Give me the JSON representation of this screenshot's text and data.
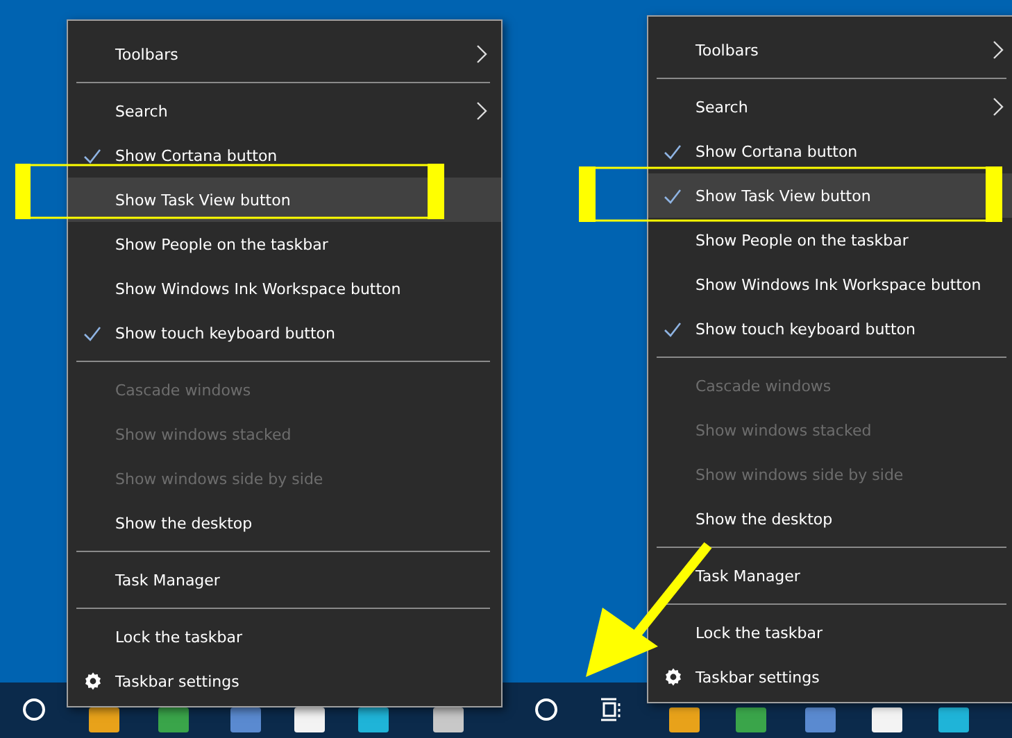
{
  "menus": [
    {
      "items": [
        {
          "kind": "item",
          "label": "Toolbars",
          "submenu": true,
          "checked": false,
          "disabled": false,
          "selected": false
        },
        {
          "kind": "separator"
        },
        {
          "kind": "item",
          "label": "Search",
          "submenu": true,
          "checked": false,
          "disabled": false,
          "selected": false
        },
        {
          "kind": "item",
          "label": "Show Cortana button",
          "submenu": false,
          "checked": true,
          "disabled": false,
          "selected": false
        },
        {
          "kind": "item",
          "label": "Show Task View button",
          "submenu": false,
          "checked": false,
          "disabled": false,
          "selected": true
        },
        {
          "kind": "item",
          "label": "Show People on the taskbar",
          "submenu": false,
          "checked": false,
          "disabled": false,
          "selected": false
        },
        {
          "kind": "item",
          "label": "Show Windows Ink Workspace button",
          "submenu": false,
          "checked": false,
          "disabled": false,
          "selected": false
        },
        {
          "kind": "item",
          "label": "Show touch keyboard button",
          "submenu": false,
          "checked": true,
          "disabled": false,
          "selected": false
        },
        {
          "kind": "separator"
        },
        {
          "kind": "item",
          "label": "Cascade windows",
          "submenu": false,
          "checked": false,
          "disabled": true,
          "selected": false
        },
        {
          "kind": "item",
          "label": "Show windows stacked",
          "submenu": false,
          "checked": false,
          "disabled": true,
          "selected": false
        },
        {
          "kind": "item",
          "label": "Show windows side by side",
          "submenu": false,
          "checked": false,
          "disabled": true,
          "selected": false
        },
        {
          "kind": "item",
          "label": "Show the desktop",
          "submenu": false,
          "checked": false,
          "disabled": false,
          "selected": false
        },
        {
          "kind": "separator"
        },
        {
          "kind": "item",
          "label": "Task Manager",
          "submenu": false,
          "checked": false,
          "disabled": false,
          "selected": false
        },
        {
          "kind": "separator"
        },
        {
          "kind": "item",
          "label": "Lock the taskbar",
          "submenu": false,
          "checked": false,
          "disabled": false,
          "selected": false
        },
        {
          "kind": "settings",
          "label": "Taskbar settings",
          "submenu": false,
          "checked": false,
          "disabled": false,
          "selected": false
        }
      ]
    },
    {
      "items": [
        {
          "kind": "item",
          "label": "Toolbars",
          "submenu": true,
          "checked": false,
          "disabled": false,
          "selected": false
        },
        {
          "kind": "separator"
        },
        {
          "kind": "item",
          "label": "Search",
          "submenu": true,
          "checked": false,
          "disabled": false,
          "selected": false
        },
        {
          "kind": "item",
          "label": "Show Cortana button",
          "submenu": false,
          "checked": true,
          "disabled": false,
          "selected": false
        },
        {
          "kind": "item",
          "label": "Show Task View button",
          "submenu": false,
          "checked": true,
          "disabled": false,
          "selected": true
        },
        {
          "kind": "item",
          "label": "Show People on the taskbar",
          "submenu": false,
          "checked": false,
          "disabled": false,
          "selected": false
        },
        {
          "kind": "item",
          "label": "Show Windows Ink Workspace button",
          "submenu": false,
          "checked": false,
          "disabled": false,
          "selected": false
        },
        {
          "kind": "item",
          "label": "Show touch keyboard button",
          "submenu": false,
          "checked": true,
          "disabled": false,
          "selected": false
        },
        {
          "kind": "separator"
        },
        {
          "kind": "item",
          "label": "Cascade windows",
          "submenu": false,
          "checked": false,
          "disabled": true,
          "selected": false
        },
        {
          "kind": "item",
          "label": "Show windows stacked",
          "submenu": false,
          "checked": false,
          "disabled": true,
          "selected": false
        },
        {
          "kind": "item",
          "label": "Show windows side by side",
          "submenu": false,
          "checked": false,
          "disabled": true,
          "selected": false
        },
        {
          "kind": "item",
          "label": "Show the desktop",
          "submenu": false,
          "checked": false,
          "disabled": false,
          "selected": false
        },
        {
          "kind": "separator"
        },
        {
          "kind": "item",
          "label": "Task Manager",
          "submenu": false,
          "checked": false,
          "disabled": false,
          "selected": false
        },
        {
          "kind": "separator"
        },
        {
          "kind": "item",
          "label": "Lock the taskbar",
          "submenu": false,
          "checked": false,
          "disabled": false,
          "selected": false
        },
        {
          "kind": "settings",
          "label": "Taskbar settings",
          "submenu": false,
          "checked": false,
          "disabled": false,
          "selected": false
        }
      ]
    }
  ]
}
